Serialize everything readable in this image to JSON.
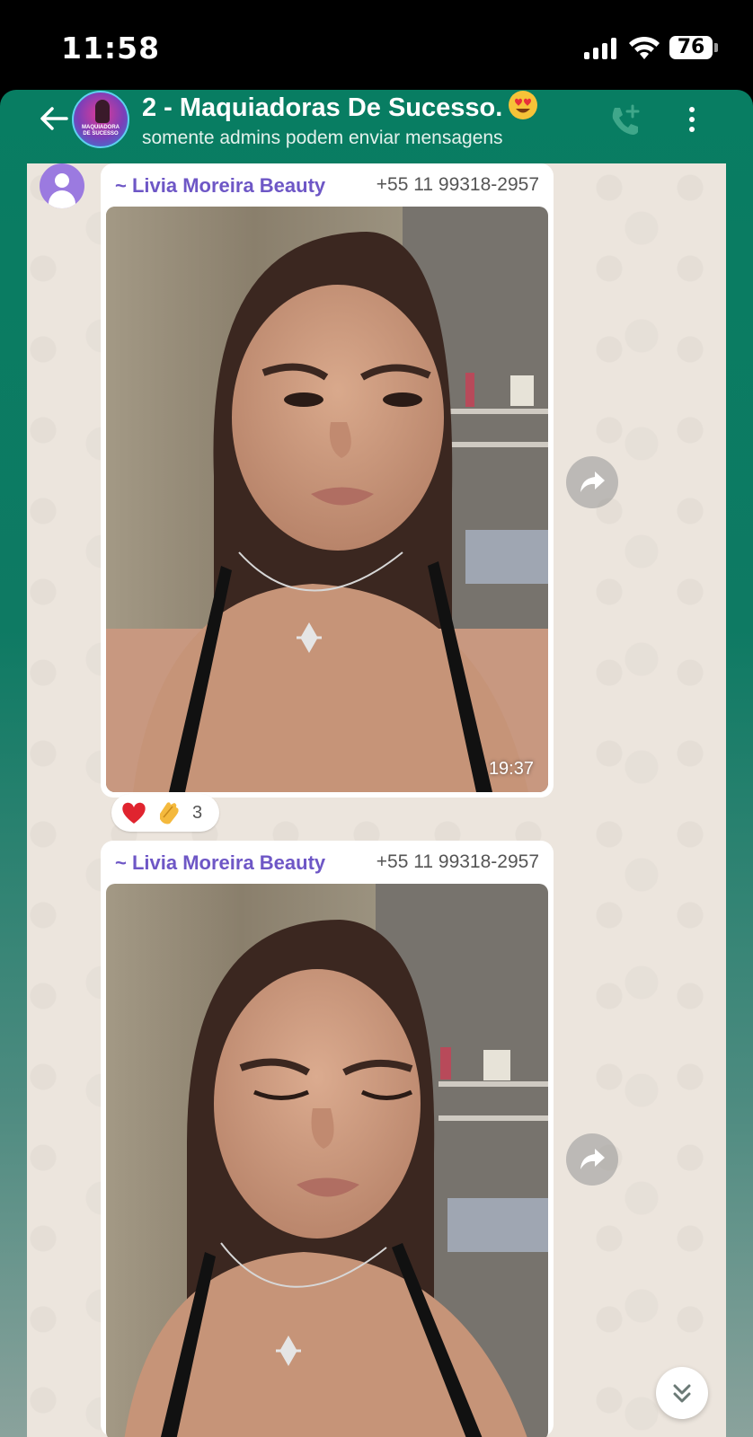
{
  "status_bar": {
    "time": "11:58",
    "battery_level": "76",
    "icons": [
      "signal-icon",
      "wifi-icon",
      "battery-icon"
    ]
  },
  "header": {
    "title": "2 - Maquiadoras De Sucesso.",
    "title_emoji": "heart-eyes-emoji",
    "subtitle": "somente admins podem enviar mensagens",
    "icons": [
      "back-arrow-icon",
      "add-call-icon",
      "more-vert-icon"
    ]
  },
  "messages": [
    {
      "sender_name": "~ Livia Moreira Beauty",
      "sender_phone": "+55 11 99318-2957",
      "type": "image",
      "image_description_icon": "photo-makeup-eyes-open",
      "time": "19:37",
      "reactions": {
        "emojis": [
          "red-heart",
          "clapping-hands"
        ],
        "count": "3"
      }
    },
    {
      "sender_name": "~ Livia Moreira Beauty",
      "sender_phone": "+55 11 99318-2957",
      "type": "image",
      "image_description_icon": "photo-makeup-eyes-closed"
    }
  ],
  "colors": {
    "header_bg": "#087d62",
    "chat_bg": "#ece5dd",
    "sender_name": "#6e57c6",
    "bubble_bg": "#ffffff"
  }
}
